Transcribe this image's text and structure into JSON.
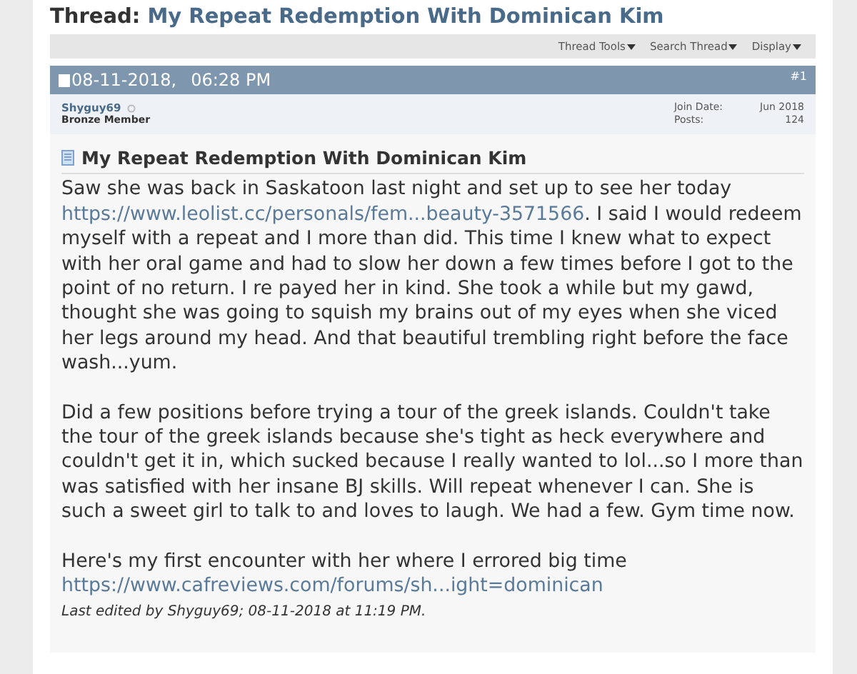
{
  "thread": {
    "label": "Thread:",
    "title": "My Repeat Redemption With Dominican Kim"
  },
  "toolbar": [
    {
      "label": "Thread Tools"
    },
    {
      "label": "Search Thread"
    },
    {
      "label": "Display"
    }
  ],
  "post": {
    "date": "08-11-2018,",
    "time": "06:28 PM",
    "number": "#1",
    "user": {
      "name": "Shyguy69",
      "rank": "Bronze Member",
      "online": false
    },
    "stats": [
      {
        "label": "Join Date:",
        "value": "Jun 2018"
      },
      {
        "label": "Posts:",
        "value": "124"
      }
    ],
    "title": "My Repeat Redemption With Dominican Kim",
    "paragraphs": [
      [
        {
          "kind": "text",
          "text": "Saw she was back in Saskatoon last night and set up to see her today"
        },
        {
          "kind": "link",
          "text": "https://www.leolist.cc/personals/fem...beauty-3571566"
        },
        {
          "kind": "text",
          "text": ". I said I would redeem myself with a repeat and I more than did. This time I knew what to expect with her oral game and had to slow her down a few times before I got to the point of no return. I re payed her in kind. She took a while but my gawd, thought she was going to squish my brains out of my eyes when she viced her legs around my head. And that beautiful trembling right before the face wash...yum."
        }
      ],
      [
        {
          "kind": "text",
          "text": "Did a few positions before trying a tour of the greek islands. Couldn't take the tour of the greek islands because she's tight as heck everywhere and couldn't get it in, which sucked because I really wanted to lol...so I more than was satisfied with her insane BJ skills. Will repeat whenever I can. She is such a sweet girl to talk to and loves to laugh. We had a few. Gym time now."
        }
      ],
      [
        {
          "kind": "text",
          "text": "Here's my first encounter with her where I errored big time"
        },
        {
          "kind": "link",
          "text": "https://www.cafreviews.com/forums/sh...ight=dominican"
        }
      ]
    ],
    "edited": "Last edited by Shyguy69; 08-11-2018 at 11:19 PM."
  }
}
